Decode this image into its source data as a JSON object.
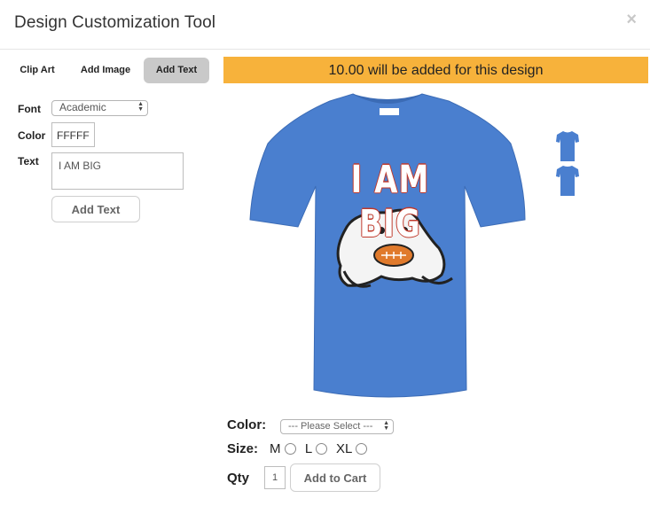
{
  "modal": {
    "title": "Design Customization Tool",
    "close": "×"
  },
  "tabs": [
    {
      "label": "Clip Art",
      "active": false
    },
    {
      "label": "Add Image",
      "active": false
    },
    {
      "label": "Add Text",
      "active": true
    }
  ],
  "banner": {
    "text": "10.00 will be added for this design",
    "color": "#f7b23b"
  },
  "form": {
    "font_label": "Font",
    "font_value": "Academic",
    "color_label": "Color",
    "color_value": "FFFFF",
    "text_label": "Text",
    "text_value": "I AM BIG",
    "add_text_button": "Add Text"
  },
  "product": {
    "shirt_color": "#4a7fcf",
    "printed_text": "I AM BIG",
    "graphic": "bulldog-with-football"
  },
  "thumbnails": [
    {
      "view": "front"
    },
    {
      "view": "back"
    }
  ],
  "options": {
    "color_label": "Color:",
    "color_placeholder": "--- Please Select ---",
    "size_label": "Size:",
    "sizes": [
      "M",
      "L",
      "XL"
    ],
    "qty_label": "Qty",
    "qty_value": "1",
    "add_to_cart": "Add to Cart"
  }
}
